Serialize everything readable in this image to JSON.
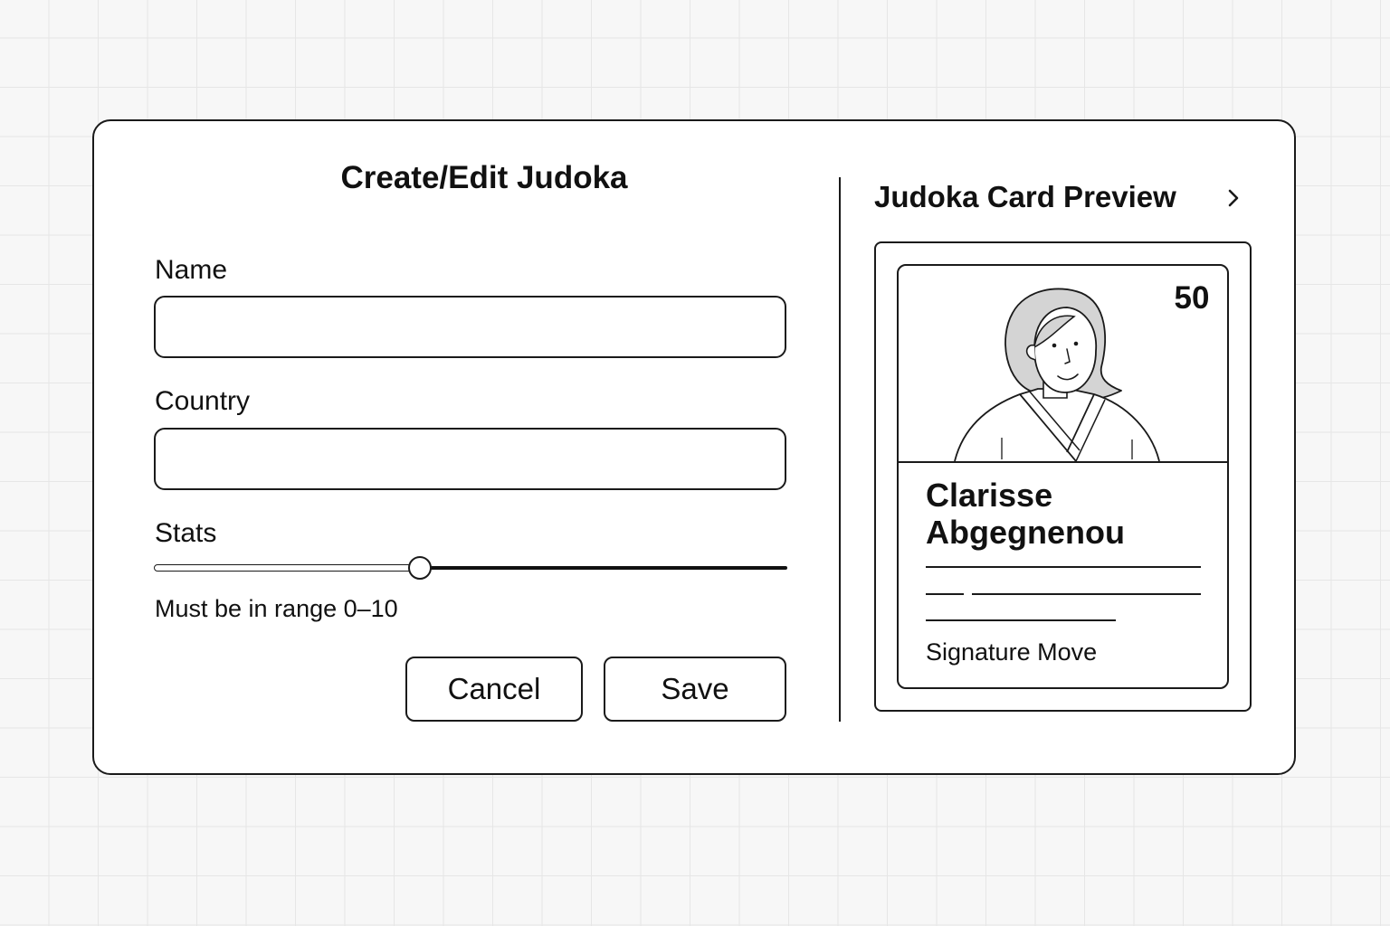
{
  "form": {
    "title": "Create/Edit Judoka",
    "name_label": "Name",
    "name_value": "",
    "country_label": "Country",
    "country_value": "",
    "stats_label": "Stats",
    "stats_slider_fraction": 0.42,
    "stats_helper": "Must be in range 0–10",
    "cancel_label": "Cancel",
    "save_label": "Save"
  },
  "preview": {
    "title": "Judoka Card Preview",
    "expand_icon": "chevron-right-icon",
    "card": {
      "score": "50",
      "name_line1": "Clarisse",
      "name_line2": "Abgegnenou",
      "signature_move": "Signature Move",
      "portrait_icon": "judoka-portrait-illustration"
    }
  },
  "colors": {
    "ink": "#1a1a1a",
    "background": "#f7f7f7",
    "grid": "#e6e6e6",
    "surface": "#ffffff",
    "hair": "#d4d4d4"
  }
}
